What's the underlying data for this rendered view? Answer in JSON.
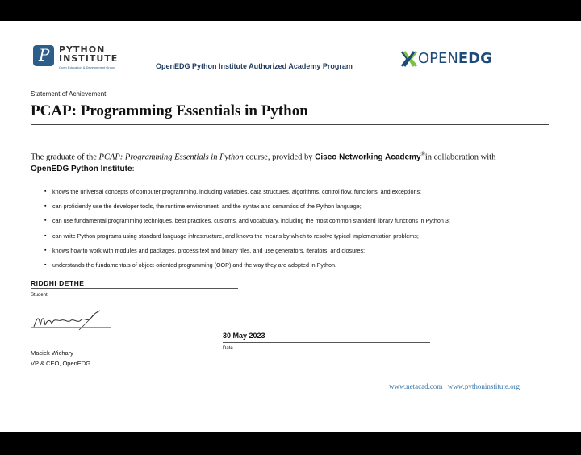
{
  "header": {
    "logo_line1": "PYTHON",
    "logo_line2": "INSTITUTE",
    "logo_tagline": "Open Education & Development Group",
    "program": "OpenEDG Python Institute Authorized Academy Program",
    "partner_logo_a": "OPEN",
    "partner_logo_b": "EDG",
    "logo_icon": "python-institute-logo",
    "partner_icon": "openedg-logo"
  },
  "certificate": {
    "kicker": "Statement of Achievement",
    "title": "PCAP: Programming Essentials in Python",
    "intro_a": "The graduate of the ",
    "intro_course": "PCAP: Programming Essentials in Python",
    "intro_b": " course, provided by ",
    "intro_org": "Cisco Networking Academy",
    "intro_reg": "®",
    "intro_c": "in collaboration with",
    "intro_org2": "OpenEDG Python Institute",
    "intro_d": ":",
    "bullets": [
      "knows the universal concepts of computer programming, including variables, data structures, algorithms, control flow, functions, and exceptions;",
      "can proficiently use the developer tools, the runtime environment, and the syntax and semantics of the Python language;",
      "can use fundamental programming techniques, best practices, customs, and vocabulary, including the most common standard library functions in Python 3;",
      "can write Python programs using standard language infrastructure, and knows the means by which to resolve typical implementation problems;",
      "knows how to work with modules and packages, process text and binary files, and use generators, iterators, and closures;",
      "understands the fundamentals of object-oriented programming (OOP) and the way they are adopted in Python."
    ]
  },
  "student": {
    "name": "RIDDHI DETHE",
    "label": "Student"
  },
  "signer": {
    "name": "Maciek Wichary",
    "role": "VP & CEO, OpenEDG"
  },
  "date": {
    "value": "30 May 2023",
    "label": "Date"
  },
  "footer": {
    "link1": "www.netacad.com",
    "sep": "|",
    "link2": "www.pythoninstitute.org"
  },
  "colors": {
    "navy": "#1e3a5c",
    "logo_blue": "#2d5e8a",
    "link": "#3b78a8",
    "green": "#7cc242"
  }
}
